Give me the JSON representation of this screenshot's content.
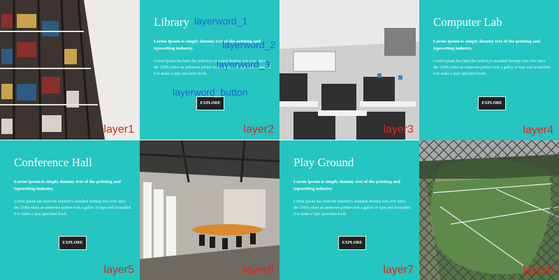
{
  "tiles": [
    {
      "layer": "layer1"
    },
    {
      "layer": "layer2",
      "title": "Library",
      "lead": "Lorem Ipsum is simply dummy text of the printing and typesetting industry.",
      "body": "Lorem Ipsum has been the industry's standard dummy text ever since the 1500s,when an unknown printer took a galley of type and scrambled it to make a type specimen book.",
      "button": "EXPLORE",
      "annotations": {
        "word1": "layerword_1",
        "word2": "layerword_2",
        "word3": "layerword_3",
        "button": "layerword_button"
      }
    },
    {
      "layer": "layer3"
    },
    {
      "layer": "layer4",
      "title": "Computer Lab",
      "lead": "Lorem Ipsum is simply dummy text of the printing and typesetting industry.",
      "body": "Lorem Ipsum has been the industry's standard dummy text ever since the 1500s,when an unknown printer took a galley of type and scrambled it to make a type specimen book.",
      "button": "EXPLORE"
    },
    {
      "layer": "layer5",
      "title": "Conference Hall",
      "lead": "Lorem Ipsum is simply dummy text of the printing and typesetting industry.",
      "body": "Lorem Ipsum has been the industry's standard dummy text ever since the 1500s,when an unknown printer took a galley of type and scrambled it to make a type specimen book.",
      "button": "EXPLORE"
    },
    {
      "layer": "layer6"
    },
    {
      "layer": "layer7",
      "title": "Play Ground",
      "lead": "Lorem Ipsum is simply dummy text of the printing and typesetting industry.",
      "body": "Lorem Ipsum has been the industry's standard dummy text ever since the 1500s,when an unknown printer took a galley of type and scrambled it to make a type specimen book.",
      "button": "EXPLORE"
    },
    {
      "layer": "layer8"
    }
  ],
  "colors": {
    "teal": "#25c5c1",
    "layer_label": "#e0251c",
    "annotation": "#2360e0",
    "button_bg": "#222222"
  }
}
